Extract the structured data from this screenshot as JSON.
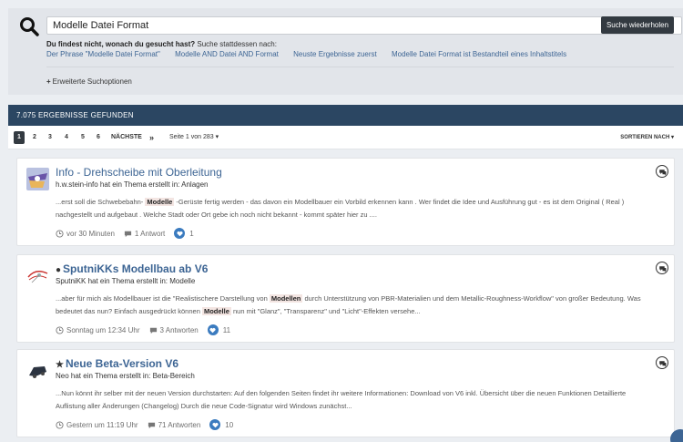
{
  "search": {
    "query": "Modelle Datei Format",
    "button_label": "Suche wiederholen",
    "suggest_bold": "Du findest nicht, wonach du gesucht hast?",
    "suggest_rest": "Suche stattdessen nach:",
    "suggestions": [
      "Der Phrase \"Modelle Datei Format\"",
      "Modelle AND Datei AND Format",
      "Neuste Ergebnisse zuerst",
      "Modelle Datei Format ist Bestandteil eines Inhaltstitels"
    ],
    "advanced_label": "Erweiterte Suchoptionen"
  },
  "results": {
    "header": "7.075 ERGEBNISSE GEFUNDEN",
    "pages": [
      "1",
      "2",
      "3",
      "4",
      "5",
      "6"
    ],
    "next_label": "NÄCHSTE",
    "last_symbol": "»",
    "page_info": "Seite 1 von 283",
    "sort_label": "SORTIEREN NACH"
  },
  "cards": [
    {
      "prefix": "",
      "title": "Info - Drehscheibe mit Oberleitung",
      "subtitle": "h.w.stein-info hat ein Thema erstellt in: Anlagen",
      "snippet_a": "...erst soll die Schwebebahn-",
      "hl1": "Modelle",
      "snippet_b": "-Gerüste fertig werden - das davon ein Modellbauer ein Vorbild erkennen kann . Wer findet die Idee und Ausführung gut - es ist dem Original ( Real ) nachgestellt und aufgebaut . Welche Stadt oder Ort gebe ich noch nicht bekannt - kommt später hier zu ....",
      "time": "vor 30 Minuten",
      "answers": "1 Antwort",
      "likes": "1"
    },
    {
      "prefix": "●",
      "title": "SputniKKs Modellbau ab V6",
      "subtitle": "SputniKK hat ein Thema erstellt in: Modelle",
      "snippet_a": "...aber für mich als Modellbauer ist die \"Realistischere Darstellung von",
      "hl1": "Modellen",
      "snippet_b": "durch Unterstützung von PBR-Materialien und dem Metallic-Roughness-Workflow\" von großer Bedeutung. Was bedeutet das nun? Einfach ausgedrückt können",
      "hl2": "Modelle",
      "snippet_c": "nun mit \"Glanz\", \"Transparenz\" und \"Licht\"-Effekten versehe...",
      "time": "Sonntag um 12:34 Uhr",
      "answers": "3 Antworten",
      "likes": "11"
    },
    {
      "prefix": "★",
      "title": "Neue Beta-Version V6",
      "subtitle": "Neo hat ein Thema erstellt in: Beta-Bereich",
      "snippet_a": "...Nun könnt ihr selber mit der neuen Version durchstarten: Auf den folgenden Seiten findet ihr weitere Informationen: Download von V6 inkl. Übersicht über die neuen Funktionen Detaillierte Auflistung aller Änderungen (Changelog) Durch die neue Code-Signatur wird Windows zunächst...",
      "time": "Gestern um 11:19 Uhr",
      "answers": "71 Antworten",
      "likes": "10"
    }
  ],
  "colors": {
    "accent": "#3d6594",
    "header_bg": "#2b4662",
    "button_bg": "#333a41",
    "highlight": "#f3e5e2",
    "like": "#3b7bbf"
  }
}
